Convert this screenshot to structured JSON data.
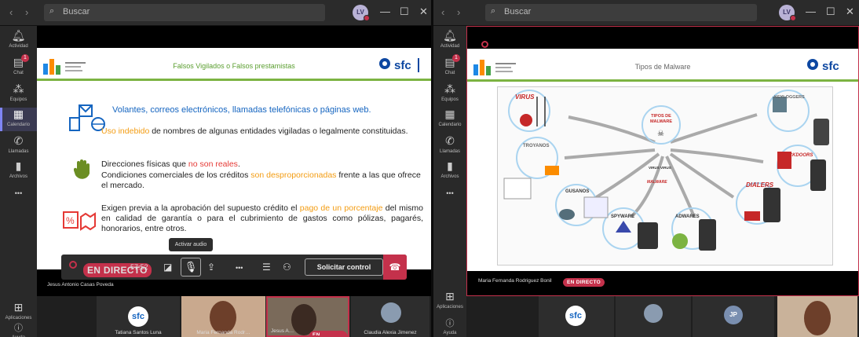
{
  "common": {
    "search_placeholder": "Buscar",
    "avatar_initials": "LV",
    "nav_back": "‹",
    "nav_forward": "›",
    "minimize": "—",
    "maximize": "☐",
    "close": "✕",
    "rail": {
      "actividad": "Actividad",
      "chat": "Chat",
      "chat_badge": "1",
      "equipos": "Equipos",
      "calendario": "Calendario",
      "llamadas": "Llamadas",
      "archivos": "Archivos",
      "more": "•••",
      "aplicaciones": "Aplicaciones",
      "ayuda": "Ayuda"
    },
    "live_label": "EN DIRECTO"
  },
  "left": {
    "slide_title": "Falsos Vigilados o Falsos prestamistas",
    "brand_right": "sfc",
    "bullet1": "Volantes, correos electrónicos, llamadas telefónicas o páginas web.",
    "p1_hl": "Uso indebido",
    "p1_rest": " de nombres de algunas entidades vigiladas o legalmente constituidas.",
    "p2a_pre": "Direcciones físicas que ",
    "p2a_hl": "no son reales",
    "p2a_post": ".",
    "p2b_pre": "Condiciones comerciales de los créditos ",
    "p2b_hl": "son desproporcionadas",
    "p2b_post": " frente a las que ofrece el mercado.",
    "p3_pre": "Exigen previa a la aprobación del supuesto crédito el ",
    "p3_hl": "pago de un porcentaje",
    "p3_post": " del mismo en calidad de garantía o para el cubrimiento de gastos como pólizas, pagarés, honorarios, entre otros.",
    "timer": "57:52",
    "tooltip": "Activar audio",
    "request_control": "Solicitar control",
    "presenter": "Jesus Antonio Casas Poveda",
    "participants": [
      {
        "name": "Tatiana Santos Luna"
      },
      {
        "name": "Maria Fernanda Rodr…"
      },
      {
        "name": "Jesus A…",
        "live": "EN DIRECTO"
      },
      {
        "name": "Claudia Alexia Jimenez"
      }
    ]
  },
  "right": {
    "slide_title": "Tipos de Malware",
    "brand_right": "sfc",
    "center": "TIPOS DE MALWARE",
    "nodes": [
      "VIRUS",
      "KEYLOGGERS",
      "TROYANOS",
      "BACKDOORS",
      "GUSANOS",
      "SPYWARE",
      "ADWARES",
      "DIALERS"
    ],
    "center_small_1": "VIRUS VIRUS",
    "center_small_2": "MALWARE",
    "presenter": "Maria Fernanda Rodriguez Bonil",
    "avatar_jp": "JP"
  }
}
